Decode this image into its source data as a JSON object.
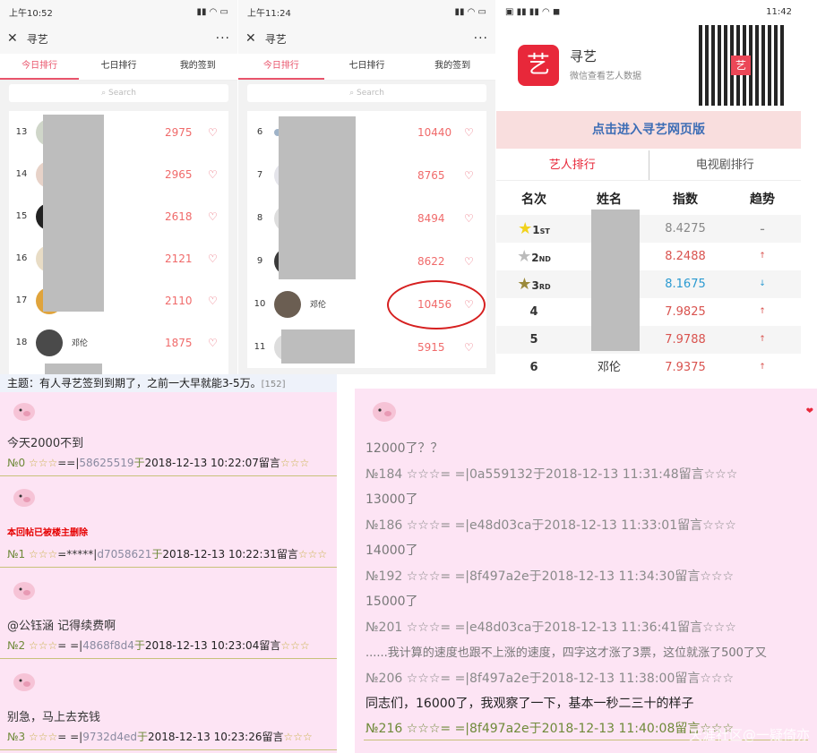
{
  "phone1": {
    "time": "上午10:52",
    "title": "寻艺",
    "more": "···",
    "close": "✕",
    "tabs": [
      "今日排行",
      "七日排行",
      "我的签到"
    ],
    "search": "Search",
    "rows": [
      {
        "rank": "13",
        "score": "2975"
      },
      {
        "rank": "14",
        "score": "2965"
      },
      {
        "rank": "15",
        "score": "2618"
      },
      {
        "rank": "16",
        "score": "2121"
      },
      {
        "rank": "17",
        "score": "2110"
      },
      {
        "rank": "18",
        "name": "邓伦",
        "score": "1875"
      }
    ]
  },
  "phone2": {
    "time": "上午11:24",
    "title": "寻艺",
    "more": "···",
    "close": "✕",
    "tabs": [
      "今日排行",
      "七日排行",
      "我的签到"
    ],
    "search": "Search",
    "rows": [
      {
        "rank": "6",
        "score": "10440"
      },
      {
        "rank": "7",
        "score": "8765"
      },
      {
        "rank": "8",
        "score": "8494"
      },
      {
        "rank": "9",
        "score": "8622"
      },
      {
        "rank": "10",
        "name": "邓伦",
        "score": "10456"
      },
      {
        "rank": "11",
        "score": "5915"
      }
    ]
  },
  "phone3": {
    "time": "11:42",
    "app_name": "寻艺",
    "app_icon": "艺",
    "app_sub": "微信查看艺人数据",
    "banner": "点击进入寻艺网页版",
    "tabs": [
      "艺人排行",
      "电视剧排行"
    ],
    "headers": [
      "名次",
      "姓名",
      "指数",
      "趋势"
    ],
    "rows": [
      {
        "rank": "1",
        "suffix": "ST",
        "value": "8.4275",
        "trend": "-"
      },
      {
        "rank": "2",
        "suffix": "ND",
        "value": "8.2488",
        "trend": "↑"
      },
      {
        "rank": "3",
        "suffix": "RD",
        "value": "8.1675",
        "trend": "↓"
      },
      {
        "rank": "4",
        "value": "7.9825",
        "trend": "↑"
      },
      {
        "rank": "5",
        "value": "7.9788",
        "trend": "↑"
      },
      {
        "rank": "6",
        "name": "邓伦",
        "value": "7.9375",
        "trend": "↑"
      }
    ]
  },
  "forum_left": {
    "topic": "主题：有人寻艺签到到期了，之前一大早就能3-5万。",
    "count": "[152]",
    "posts": [
      {
        "text": "今天2000不到",
        "no": "№0",
        "stars": "☆☆☆",
        "sep": "==|",
        "user": "58625519",
        "yu": "于",
        "time": "2018-12-13 10:22:07留言",
        "tail": "☆☆☆"
      },
      {
        "text": "本回帖已被楼主删除",
        "no": "№1",
        "stars": "☆☆☆",
        "sep": "=*****|",
        "user": "d7058621",
        "yu": "于",
        "time": "2018-12-13 10:22:31留言",
        "tail": "☆☆☆"
      },
      {
        "text": "@公钰涵 记得续费啊",
        "no": "№2",
        "stars": "☆☆☆",
        "sep": "= =|",
        "user": "4868f8d4",
        "yu": "于",
        "time": "2018-12-13 10:23:04留言",
        "tail": "☆☆☆"
      },
      {
        "text": "别急，马上去充钱",
        "no": "№3",
        "stars": "☆☆☆",
        "sep": "= =|",
        "user": "9732d4ed",
        "yu": "于",
        "time": "2018-12-13 10:23:26留言",
        "tail": "☆☆☆"
      }
    ]
  },
  "forum_right": {
    "heart": "❤",
    "lines": [
      {
        "kind": "text",
        "v": "12000了？？"
      },
      {
        "kind": "meta",
        "v": "№184 ☆☆☆= =|0a559132于2018-12-13 11:31:48留言☆☆☆"
      },
      {
        "kind": "text",
        "v": "13000了"
      },
      {
        "kind": "meta",
        "v": "№186 ☆☆☆= =|e48d03ca于2018-12-13 11:33:01留言☆☆☆"
      },
      {
        "kind": "text",
        "v": "14000了"
      },
      {
        "kind": "meta",
        "v": "№192 ☆☆☆= =|8f497a2e于2018-12-13 11:34:30留言☆☆☆"
      },
      {
        "kind": "text",
        "v": "15000了"
      },
      {
        "kind": "meta",
        "v": "№201 ☆☆☆= =|e48d03ca于2018-12-13 11:36:41留言☆☆☆"
      },
      {
        "kind": "text",
        "v": "......我计算的速度也跟不上涨的速度，四字这才涨了3票，这位就涨了500了又"
      },
      {
        "kind": "meta",
        "v": "№206 ☆☆☆= =|8f497a2e于2018-12-13 11:38:00留言☆☆☆"
      },
      {
        "kind": "textdark",
        "v": "同志们，16000了，我观察了一下，基本一秒二三十的样子"
      },
      {
        "kind": "meta2",
        "v": "№216 ☆☆☆= =|8f497a2e于2018-12-13 11:40:08留言☆☆☆"
      }
    ],
    "watermark": "天涯社区@一疑倚亦"
  },
  "colors": {
    "accent": "#e9546b",
    "forum_bg": "#fde4f4",
    "banner_bg": "#f9dede"
  }
}
